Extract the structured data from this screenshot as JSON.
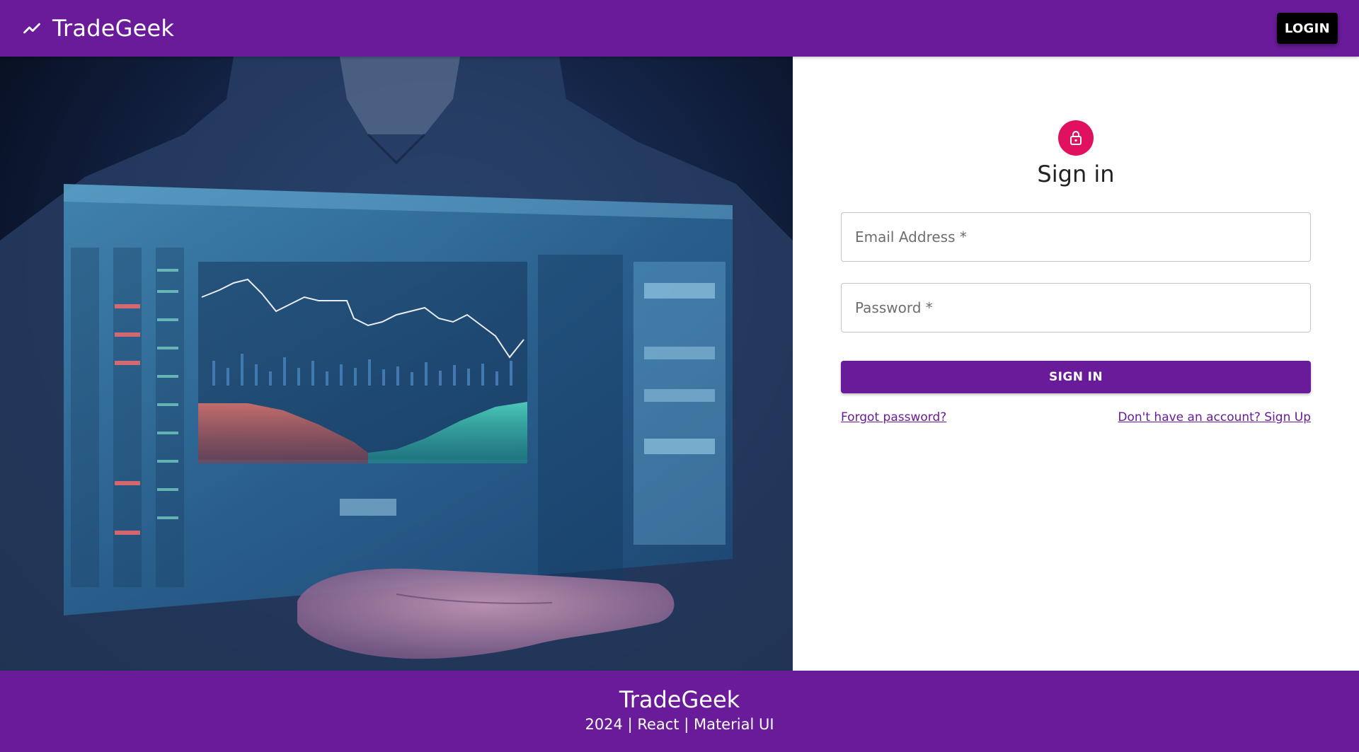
{
  "header": {
    "brand_icon": "trending-up-icon",
    "brand_title": "TradeGeek",
    "login_label": "LOGIN"
  },
  "hero": {
    "image": "person-holding-holographic-trading-chart"
  },
  "signin": {
    "icon": "lock-icon",
    "title": "Sign in",
    "email_placeholder": "Email Address *",
    "password_placeholder": "Password *",
    "submit_label": "SIGN IN",
    "forgot_label": "Forgot password?",
    "signup_label": "Don't have an account? Sign Up"
  },
  "footer": {
    "title": "TradeGeek",
    "subtitle": "2024 | React | Material UI"
  },
  "colors": {
    "primary": "#6a1b9a",
    "avatar": "#e0115f",
    "login_button": "#000000"
  }
}
